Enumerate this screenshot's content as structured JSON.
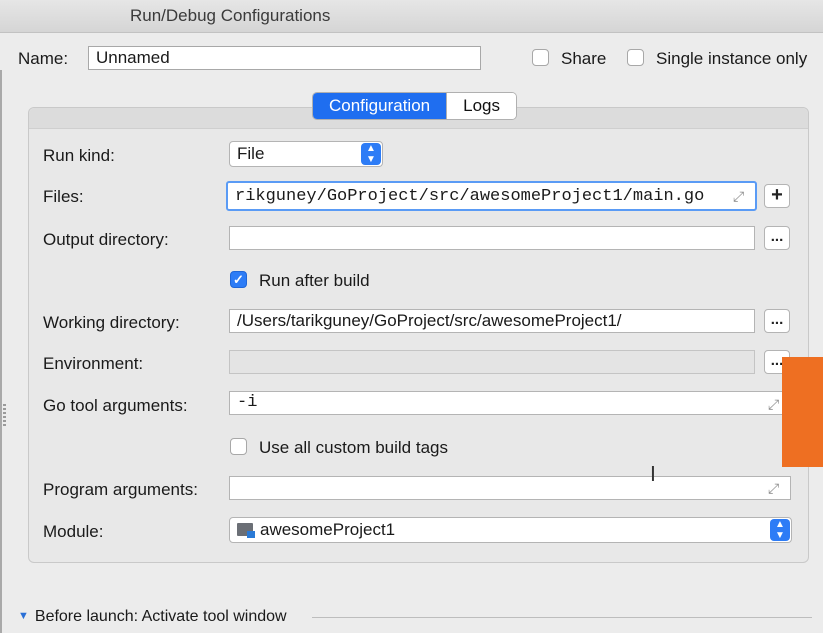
{
  "window": {
    "title": "Run/Debug Configurations"
  },
  "header": {
    "name_label": "Name:",
    "name_value": "Unnamed",
    "share_label": "Share",
    "share_checked": false,
    "single_instance_label": "Single instance only",
    "single_instance_checked": false
  },
  "tabs": [
    {
      "label": "Configuration",
      "active": true
    },
    {
      "label": "Logs",
      "active": false
    }
  ],
  "form": {
    "run_kind": {
      "label": "Run kind:",
      "value": "File"
    },
    "files": {
      "label": "Files:",
      "value": "rikguney/GoProject/src/awesomeProject1/main.go",
      "add_button": "+"
    },
    "output_directory": {
      "label": "Output directory:",
      "value": "",
      "browse_button": "..."
    },
    "run_after_build": {
      "label": "Run after build",
      "checked": true
    },
    "working_directory": {
      "label": "Working directory:",
      "value": "/Users/tarikguney/GoProject/src/awesomeProject1/",
      "browse_button": "..."
    },
    "environment": {
      "label": "Environment:",
      "value": "",
      "browse_button": "..."
    },
    "go_tool_arguments": {
      "label": "Go tool arguments:",
      "value": "-i"
    },
    "use_custom_build_tags": {
      "label": "Use all custom build tags",
      "checked": false
    },
    "program_arguments": {
      "label": "Program arguments:",
      "value": ""
    },
    "module": {
      "label": "Module:",
      "value": "awesomeProject1"
    }
  },
  "before_launch": {
    "label": "Before launch: Activate tool window"
  },
  "icons": {
    "expand": "expand-arrows-icon",
    "stepper": "updown-stepper-icon",
    "folder": "module-folder-icon",
    "check": "checkmark-icon",
    "disclosure": "disclosure-triangle-icon",
    "text_cursor": "i-beam-cursor-icon"
  },
  "colors": {
    "accent": "#1f6ef0",
    "overlay": "#ee6f22"
  }
}
